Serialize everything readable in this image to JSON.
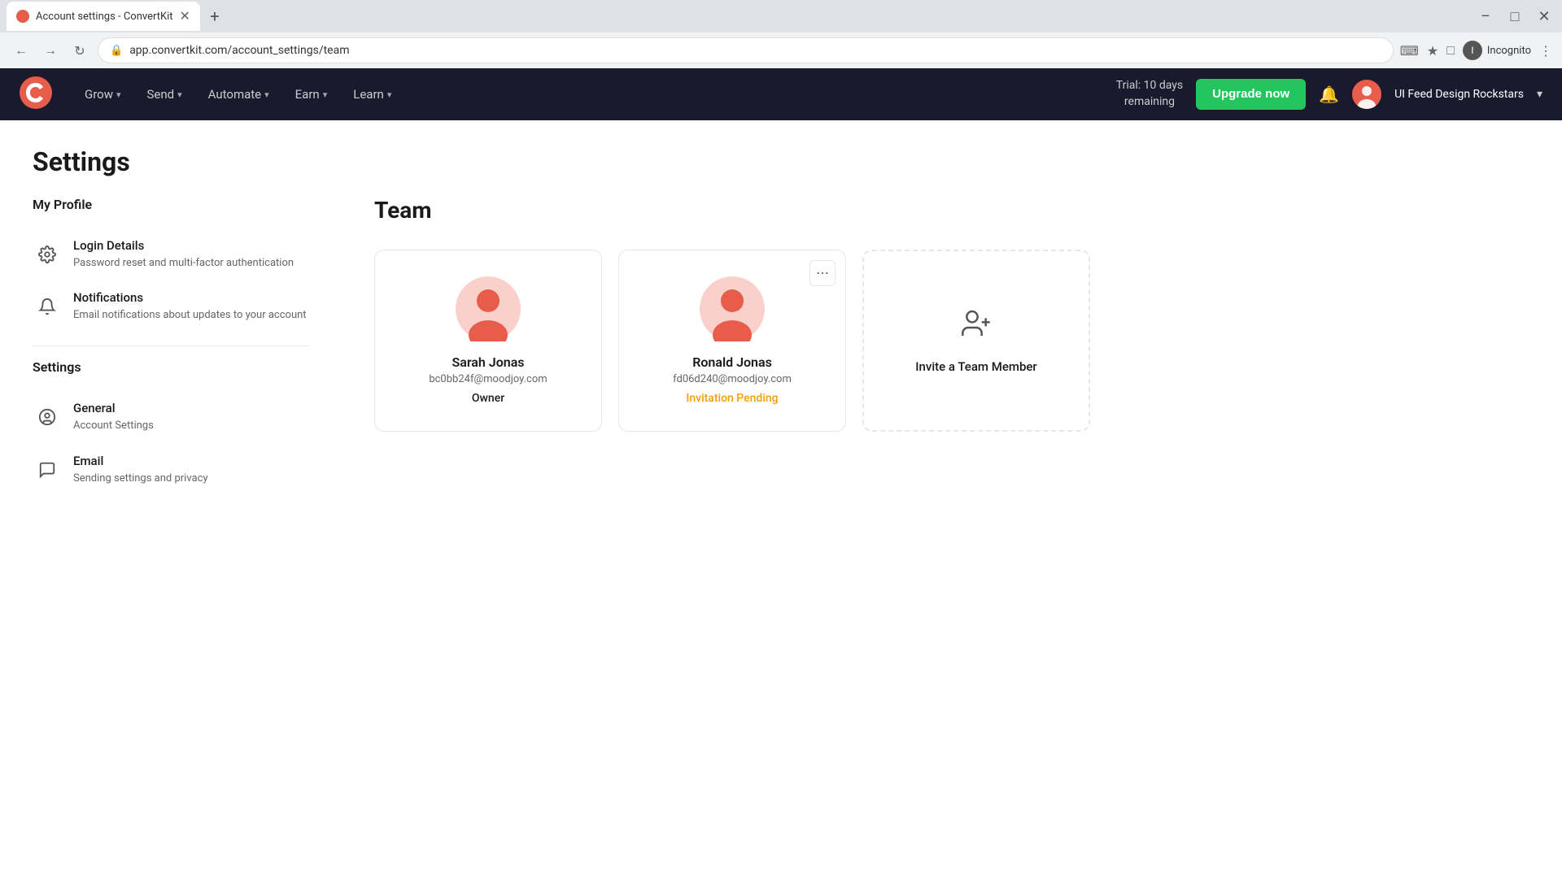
{
  "browser": {
    "tab_title": "Account settings - ConvertKit",
    "tab_favicon": "ck",
    "url": "app.convertkit.com/account_settings/team",
    "new_tab_label": "+",
    "incognito_label": "Incognito"
  },
  "nav": {
    "logo_alt": "ConvertKit Logo",
    "items": [
      {
        "label": "Grow",
        "has_chevron": true
      },
      {
        "label": "Send",
        "has_chevron": true
      },
      {
        "label": "Automate",
        "has_chevron": true
      },
      {
        "label": "Earn",
        "has_chevron": true
      },
      {
        "label": "Learn",
        "has_chevron": true
      }
    ],
    "trial_text": "Trial: 10 days\nremaining",
    "upgrade_label": "Upgrade\nnow",
    "workspace_name": "UI Feed Design Rockstars",
    "workspace_chevron": "▾"
  },
  "page": {
    "title": "Settings"
  },
  "sidebar": {
    "my_profile_title": "My Profile",
    "login_details_label": "Login Details",
    "login_details_desc": "Password reset and multi-factor authentication",
    "notifications_label": "Notifications",
    "notifications_desc": "Email notifications about updates to your account",
    "settings_title": "Settings",
    "general_label": "General",
    "general_desc": "Account Settings",
    "email_label": "Email",
    "email_desc": "Sending settings and privacy"
  },
  "team": {
    "section_title": "Team",
    "members": [
      {
        "name": "Sarah Jonas",
        "email": "bc0bb24f@moodjoy.com",
        "role": "Owner",
        "role_type": "owner",
        "has_menu": false
      },
      {
        "name": "Ronald Jonas",
        "email": "fd06d240@moodjoy.com",
        "role": "Invitation Pending",
        "role_type": "pending",
        "has_menu": true
      }
    ],
    "invite_label": "Invite a Team Member"
  }
}
